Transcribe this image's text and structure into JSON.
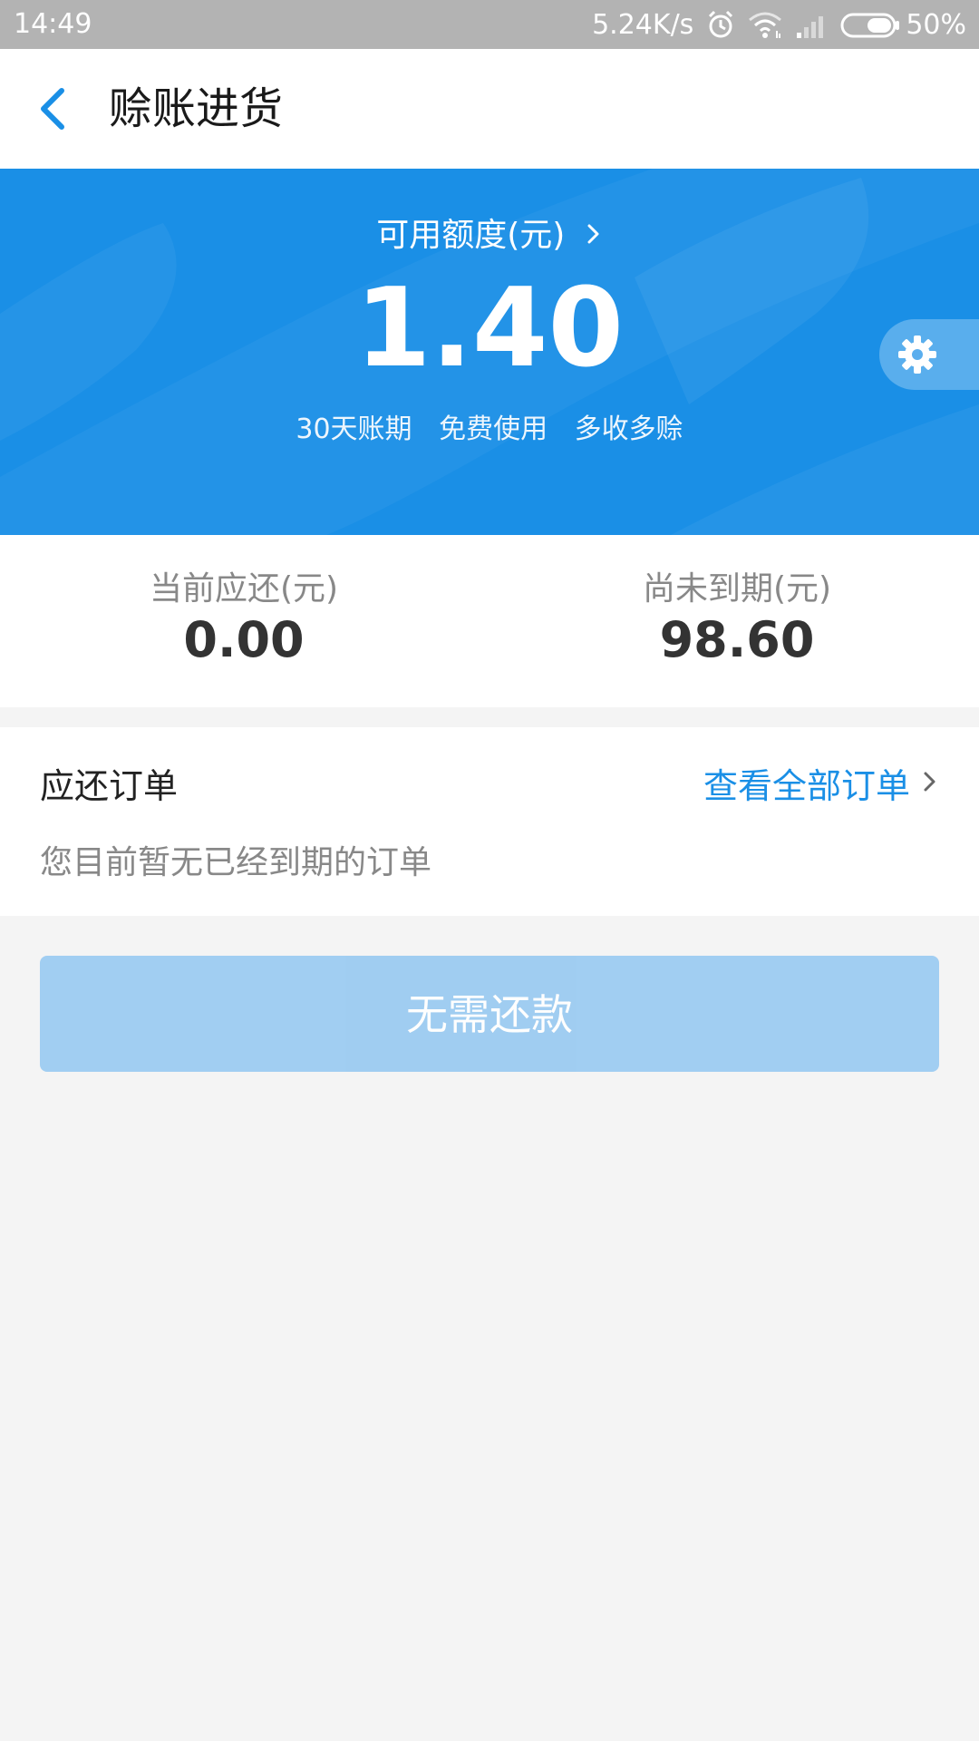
{
  "status_bar": {
    "time": "14:49",
    "net_speed": "5.24K/s",
    "battery": "50%",
    "icons": [
      "alarm-icon",
      "wifi-icon",
      "signal-icon",
      "battery-icon"
    ]
  },
  "header": {
    "title": "赊账进货",
    "back_icon": "chevron-left-icon"
  },
  "credit": {
    "label": "可用额度(元)",
    "amount": "1.40",
    "taglines": [
      "30天账期",
      "免费使用",
      "多收多赊"
    ],
    "settings_icon": "gear-icon"
  },
  "summary": {
    "current_due_label": "当前应还(元)",
    "current_due_value": "0.00",
    "not_due_label": "尚未到期(元)",
    "not_due_value": "98.60"
  },
  "orders": {
    "title": "应还订单",
    "view_all": "查看全部订单",
    "empty_message": "您目前暂无已经到期的订单"
  },
  "repay_button": {
    "label": "无需还款"
  },
  "colors": {
    "accent": "#1a8fe6",
    "status_bar": "#b3b3b3",
    "button_disabled": "#9ccbf1",
    "background": "#f4f4f4"
  }
}
